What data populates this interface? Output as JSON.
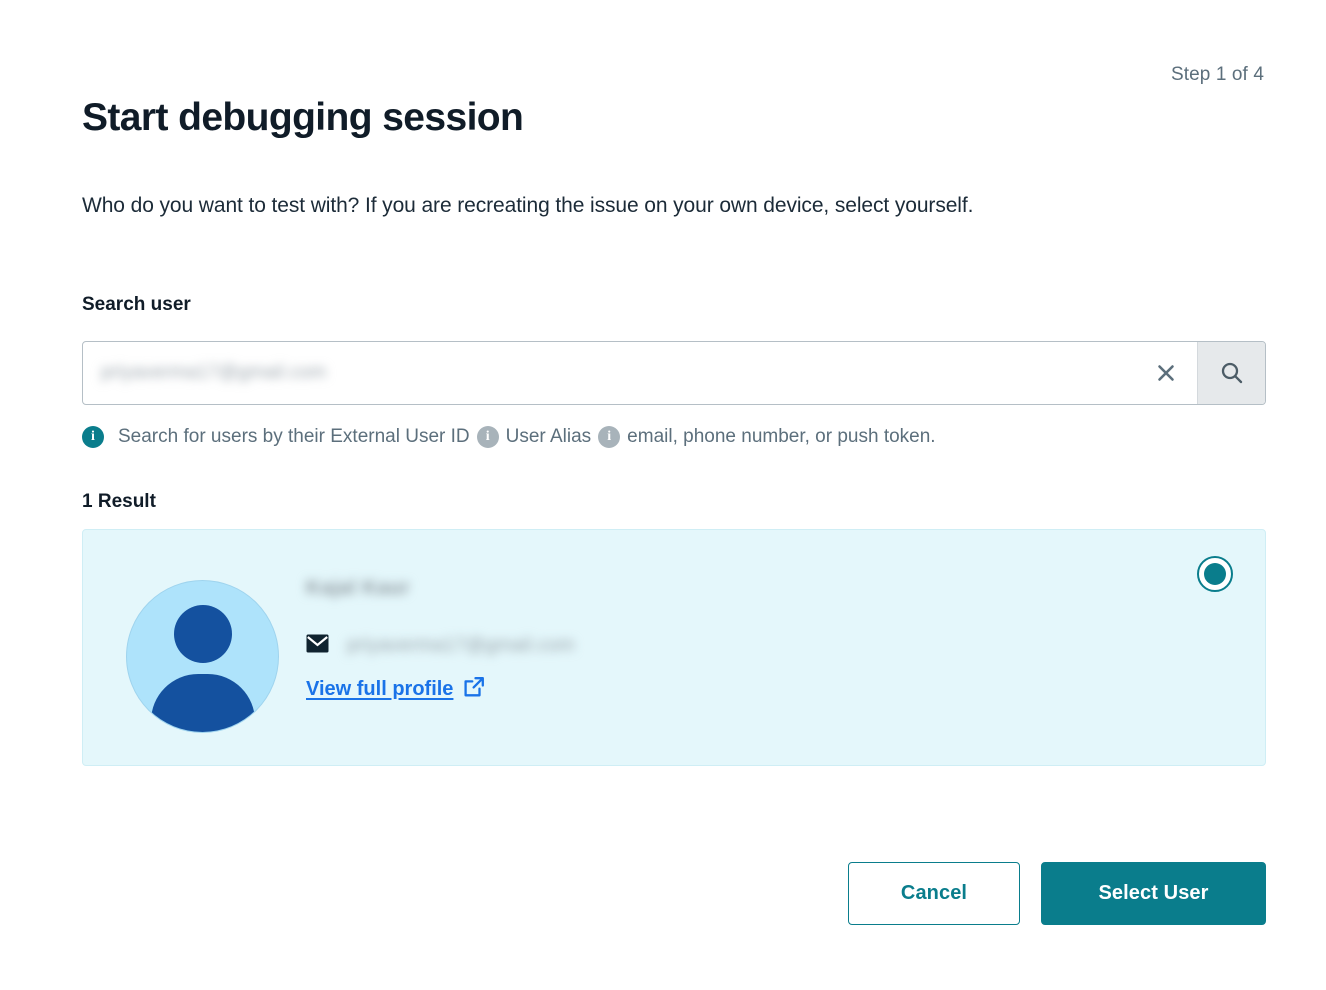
{
  "header": {
    "step_indicator": "Step 1 of 4",
    "title": "Start debugging session",
    "subtitle": "Who do you want to test with? If you are recreating the issue on your own device, select yourself."
  },
  "search": {
    "label": "Search user",
    "value": "priyaverma17@gmail.com",
    "placeholder": "",
    "clear_icon": "close-icon",
    "search_icon": "search-icon",
    "helper": {
      "segment_1": "Search for users by their External User ID",
      "segment_2": "User Alias",
      "segment_3": "email, phone number, or push token.",
      "icon_1": "info-icon",
      "icon_2": "info-icon",
      "icon_3": "info-icon",
      "icon_1_color": "#0a7d8c",
      "icon_2_color": "#a8b3ba",
      "icon_3_color": "#a8b3ba"
    }
  },
  "results": {
    "count_label": "1 Result",
    "items": [
      {
        "name": "Kajal Kaur",
        "email": "priyaverma17@gmail.com",
        "profile_link_label": "View full profile",
        "avatar_icon": "user-avatar-icon",
        "email_icon": "envelope-icon",
        "external_link_icon": "external-link-icon",
        "selected": true
      }
    ]
  },
  "footer": {
    "cancel_label": "Cancel",
    "primary_label": "Select User"
  },
  "colors": {
    "accent_teal": "#0a7d8c",
    "link_blue": "#1a73e8",
    "card_background": "#e4f7fb",
    "avatar_background": "#aee3fb",
    "avatar_figure": "#14519f",
    "text_muted": "#5c6f7c",
    "text_dark": "#101c28"
  }
}
